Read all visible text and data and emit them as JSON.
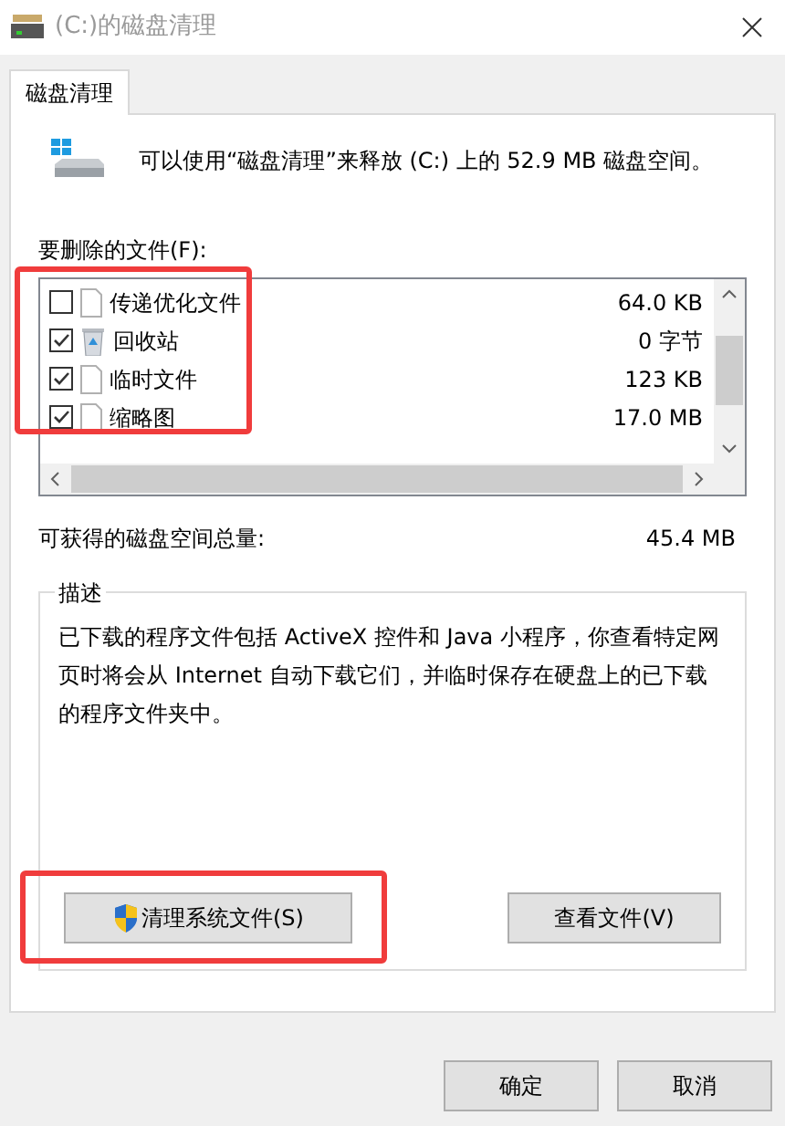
{
  "window": {
    "title": "(C:)的磁盘清理"
  },
  "tabs": [
    {
      "label": "磁盘清理",
      "selected": true
    }
  ],
  "summary": "可以使用“磁盘清理”来释放  (C:) 上的 52.9 MB 磁盘空间。",
  "files_label": "要删除的文件(F):",
  "files": [
    {
      "name": "传递优化文件",
      "size": "64.0 KB",
      "checked": false,
      "kind": "file"
    },
    {
      "name": "回收站",
      "size": "0 字节",
      "checked": true,
      "kind": "recycle-bin"
    },
    {
      "name": "临时文件",
      "size": "123 KB",
      "checked": true,
      "kind": "file"
    },
    {
      "name": "缩略图",
      "size": "17.0 MB",
      "checked": true,
      "kind": "file"
    }
  ],
  "total": {
    "label": "可获得的磁盘空间总量:",
    "value": "45.4 MB"
  },
  "description": {
    "title": "描述",
    "text": "已下载的程序文件包括 ActiveX 控件和 Java 小程序，你查看特定网页时将会从 Internet 自动下载它们，并临时保存在硬盘上的已下载的程序文件夹中。"
  },
  "actions": [
    {
      "label": "清理系统文件(S)",
      "kind": "shield"
    },
    {
      "label": "查看文件(V)",
      "kind": "plain"
    }
  ],
  "buttons": [
    "确定",
    "取消"
  ]
}
